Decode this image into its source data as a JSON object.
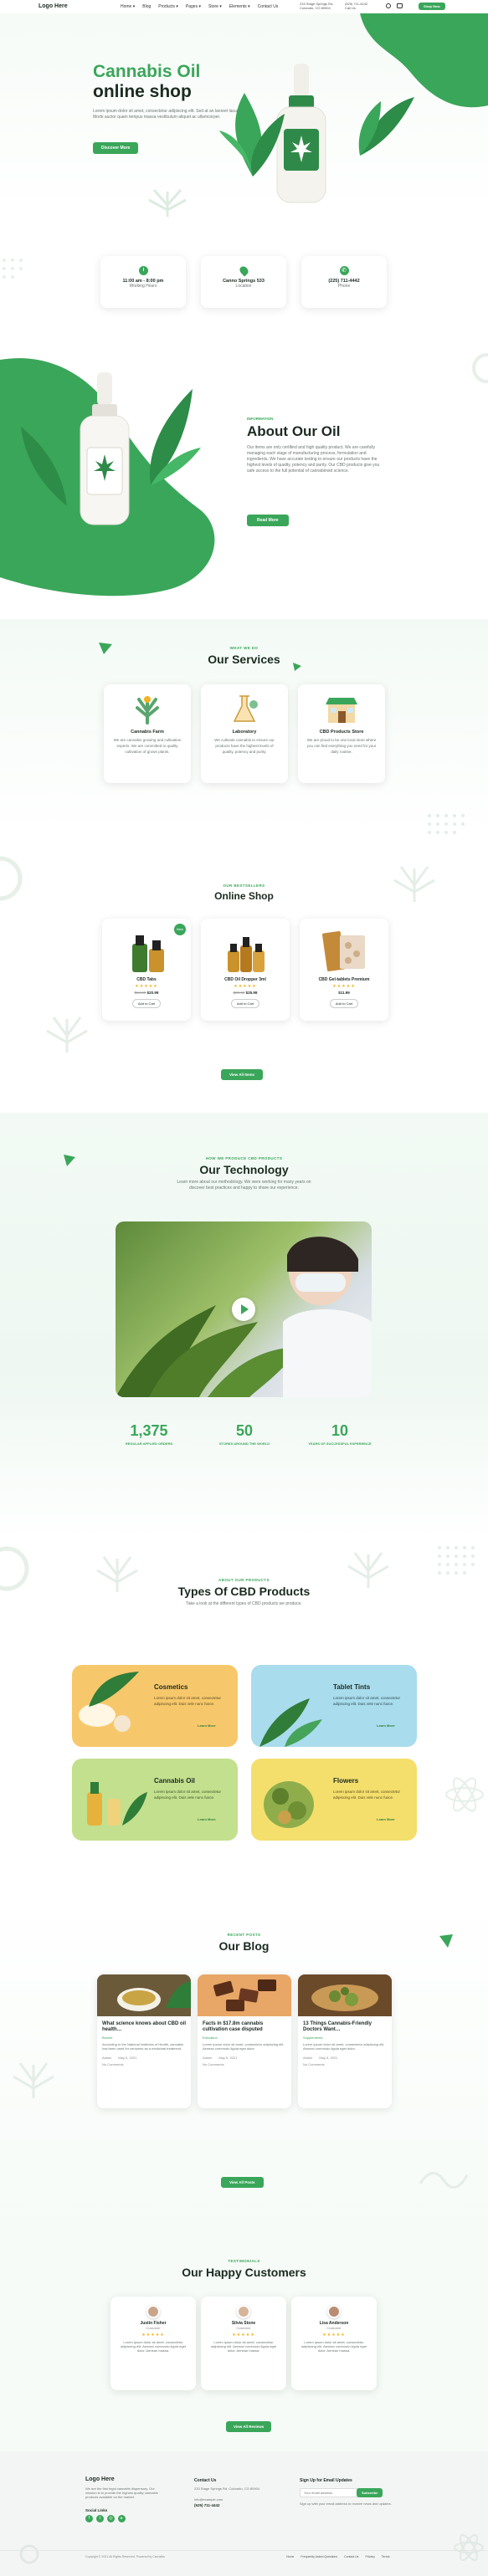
{
  "header": {
    "logo": "Logo Here",
    "nav": [
      "Home ▾",
      "Blog",
      "Products ▾",
      "Pages ▾",
      "Store ▾",
      "Elements ▾",
      "Contact Us"
    ],
    "address_line1": "233 Stage Springs Rd,",
    "address_line2": "Colorado, CO 80904",
    "phone_line1": "(525) 711-4442",
    "phone_line2": "Call Us",
    "cta": "Shop Now"
  },
  "hero": {
    "title_line1": "Cannabis Oil",
    "title_line2": "online shop",
    "body": "Lorem ipsum dolor sit amet, consectetur adipiscing elit. Sed at an laoreet lacus. Morbi auctor quam tempus massa vestibulum aliquet ac ullamcorper.",
    "button": "Discover More"
  },
  "info_cards": [
    {
      "icon": "clock-icon",
      "title": "11:00 am - 8:00 pm",
      "subtitle": "Working Hours"
    },
    {
      "icon": "pin-icon",
      "title": "Canno Springs 533",
      "subtitle": "Location"
    },
    {
      "icon": "phone-icon",
      "title": "(225) 711-4442",
      "subtitle": "Phone"
    }
  ],
  "about": {
    "eyebrow": "Information",
    "title": "About Our Oil",
    "body": "Our items are only certified and high quality product. We are carefully managing each stage of manufacturing process, formulation and ingredients. We have accurate testing to ensure our products have the highest levels of quality, potency and purity. Our CBD products give you safe access to the full potential of cannabinoid science.",
    "button": "Read More"
  },
  "services": {
    "eyebrow": "What We Do",
    "title": "Our Services",
    "items": [
      {
        "title": "Cannabis Farm",
        "body": "We are cannabis growing and cultivation experts. We are committed to quality cultivation of grown plants."
      },
      {
        "title": "Laboratory",
        "body": "We cultivate cannabis to ensure our products have the highest levels of quality, potency and purity."
      },
      {
        "title": "CBD Products Store",
        "body": "We are proud to be one local store where you can find everything you need for your daily routine."
      }
    ]
  },
  "shop": {
    "eyebrow": "Our Bestsellers",
    "title": "Online Shop",
    "button": "View All Items",
    "items": [
      {
        "name": "CBD Tabs",
        "old_price": "$24.99",
        "price": "$20.99",
        "cart": "Add to Cart",
        "badge": "New"
      },
      {
        "name": "CBD Oil Dropper 3ml",
        "old_price": "$29.99",
        "price": "$25.99",
        "cart": "Add to Cart",
        "badge": ""
      },
      {
        "name": "CBD Gel-tablets Premium",
        "old_price": "",
        "price": "$11.99",
        "cart": "Add to Cart",
        "badge": ""
      }
    ]
  },
  "technology": {
    "eyebrow": "How We Produce CBD Products",
    "title": "Our Technology",
    "body": "Learn more about our methodology. We were working for many years on discover best practices and happy to share our experience.",
    "stats": [
      {
        "value": "1,375",
        "label": "Regular Applied Orders"
      },
      {
        "value": "50",
        "label": "Stores Around the World"
      },
      {
        "value": "10",
        "label": "Years of Successful Experience"
      }
    ]
  },
  "types": {
    "eyebrow": "About Our Products",
    "title": "Types Of CBD Products",
    "body": "Take a look at the different types of CBD products we produce.",
    "items": [
      {
        "title": "Cosmetics",
        "body": "Lorem ipsum dolor sit amet, consectetur adipiscing elit. Duis vele nunc fusce.",
        "link": "Learn More"
      },
      {
        "title": "Tablet Tints",
        "body": "Lorem ipsum dolor sit amet, consectetur adipiscing elit. Duis vele nunc fusce.",
        "link": "Learn More"
      },
      {
        "title": "Cannabis Oil",
        "body": "Lorem ipsum dolor sit amet, consectetur adipiscing elit. Duis vele nunc fusce.",
        "link": "Learn More"
      },
      {
        "title": "Flowers",
        "body": "Lorem ipsum dolor sit amet, consectetur adipiscing elit. Duis vele nunc fusce.",
        "link": "Learn More"
      }
    ]
  },
  "blog": {
    "eyebrow": "Recent Posts",
    "title": "Our Blog",
    "button": "View All Posts",
    "posts": [
      {
        "title": "What science knows about CBD oil health…",
        "author": "Bonnie",
        "body": "According to the National Institutes of Health, cannabis has been used for centuries as a medicinal treatment.",
        "meta1": "Admin",
        "meta2": "May 5, 2021",
        "meta3": "No Comments"
      },
      {
        "title": "Facts in $17.8m cannabis cultivation case disputed",
        "author": "Education",
        "body": "Lorem ipsum dolor sit amet, consectetur adipiscing elit. Aenean commodo ligula eget dolor.",
        "meta1": "Admin",
        "meta2": "May 5, 2021",
        "meta3": "No Comments"
      },
      {
        "title": "13 Things Cannabis-Friendly Doctors Want…",
        "author": "Supplements",
        "body": "Lorem ipsum dolor sit amet, consectetur adipiscing elit. Aenean commodo ligula eget dolor.",
        "meta1": "Admin",
        "meta2": "May 5, 2021",
        "meta3": "No Comments"
      }
    ]
  },
  "testimonials": {
    "eyebrow": "Testimonials",
    "title": "Our Happy Customers",
    "button": "View All Reviews",
    "items": [
      {
        "name": "Justin Fisher",
        "role": "Customer",
        "body": "Lorem ipsum dolor sit amet, consectetur adipiscing elit. Aenean commodo ligula eget dolor. Aenean massa."
      },
      {
        "name": "Silvia Stone",
        "role": "Customer",
        "body": "Lorem ipsum dolor sit amet, consectetur adipiscing elit. Aenean commodo ligula eget dolor. Aenean massa."
      },
      {
        "name": "Lisa Anderson",
        "role": "Customer",
        "body": "Lorem ipsum dolor sit amet, consectetur adipiscing elit. Aenean commodo ligula eget dolor. Aenean massa."
      }
    ]
  },
  "footer": {
    "logo": "Logo Here",
    "about": "We are the first legal cannabis dispensary. Our mission is to provide the highest quality cannabis products available on the market.",
    "social_title": "Social Links",
    "contact_title": "Contact Us",
    "contact_address": "233 Stage Springs Rd, Colorado, CO 80904",
    "contact_email": "info@example.com",
    "contact_phone": "(525) 711-4442",
    "signup_title": "Sign Up for Email Updates",
    "signup_placeholder": "Your email address",
    "signup_button": "Subscribe",
    "signup_note": "Sign up with your email address to receive news and updates.",
    "copyright": "Copyright © 2021 All Rights Reserved. Powered by Cannabis",
    "links": [
      "Home",
      "Frequently Asked Questions",
      "Contact Us",
      "Privacy",
      "Terms"
    ]
  },
  "colors": {
    "accent": "#3aa65a",
    "dark": "#1b2b20"
  }
}
